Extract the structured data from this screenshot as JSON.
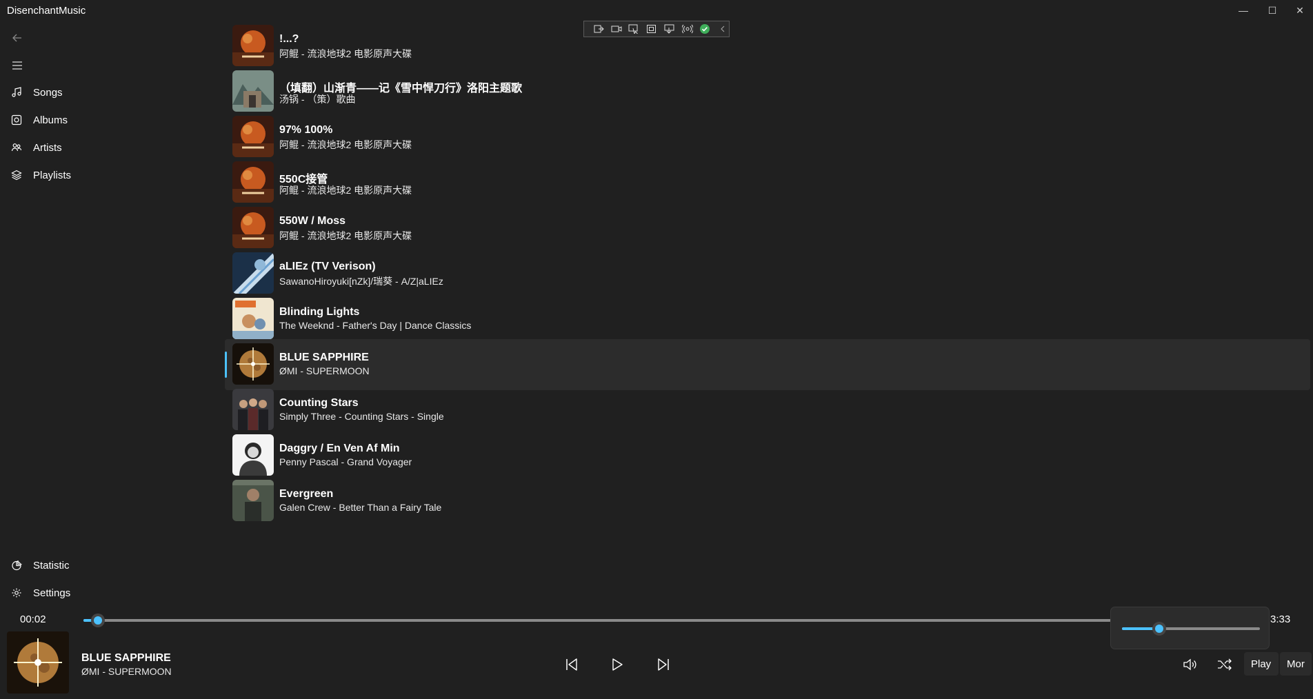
{
  "app": {
    "title": "DisenchantMusic",
    "window_buttons": {
      "minimize": "—",
      "maximize": "☐",
      "close": "✕"
    }
  },
  "sidebar": {
    "back_icon": "back-arrow-icon",
    "menu_icon": "hamburger-menu-icon",
    "items": [
      {
        "label": "Songs",
        "icon": "music-note-icon"
      },
      {
        "label": "Albums",
        "icon": "album-icon"
      },
      {
        "label": "Artists",
        "icon": "people-icon"
      },
      {
        "label": "Playlists",
        "icon": "layers-icon"
      }
    ],
    "footer_items": [
      {
        "label": "Statistic",
        "icon": "pie-chart-icon"
      },
      {
        "label": "Settings",
        "icon": "gear-icon"
      }
    ]
  },
  "songs": [
    {
      "title": "!...?",
      "subtitle": "阿鲲 - 流浪地球2 电影原声大碟",
      "cover": "wandering-earth"
    },
    {
      "title": "（填翻）山渐青——记《雪中悍刀行》洛阳主题歌",
      "subtitle": "汤锅 - （策）歌曲",
      "cover": "mountain"
    },
    {
      "title": "97% 100%",
      "subtitle": "阿鲲 - 流浪地球2 电影原声大碟",
      "cover": "wandering-earth"
    },
    {
      "title": "550C接管",
      "subtitle": "阿鲲 - 流浪地球2 电影原声大碟",
      "cover": "wandering-earth"
    },
    {
      "title": "550W / Moss",
      "subtitle": "阿鲲 - 流浪地球2 电影原声大碟",
      "cover": "wandering-earth"
    },
    {
      "title": "aLIEz (TV Verison)",
      "subtitle": "SawanoHiroyuki[nZk]/瑞葵 - A/Z|aLIEz",
      "cover": "aliez"
    },
    {
      "title": "Blinding Lights",
      "subtitle": "The Weeknd - Father's Day | Dance Classics",
      "cover": "fathers-day"
    },
    {
      "title": "BLUE SAPPHIRE",
      "subtitle": "ØMI - SUPERMOON",
      "cover": "supermoon",
      "selected": true
    },
    {
      "title": "Counting Stars",
      "subtitle": "Simply Three - Counting Stars - Single",
      "cover": "simply-three"
    },
    {
      "title": "Daggry / En Ven Af Min",
      "subtitle": "Penny Pascal - Grand Voyager",
      "cover": "portrait-bw"
    },
    {
      "title": "Evergreen",
      "subtitle": "Galen Crew - Better Than a Fairy Tale",
      "cover": "evergreen"
    }
  ],
  "player": {
    "current_time": "00:02",
    "total_time": "3:33",
    "progress_fraction": 0.014,
    "volume_fraction": 0.27,
    "now_playing": {
      "title": "BLUE SAPPHIRE",
      "subtitle": "ØMI - SUPERMOON"
    },
    "buttons": {
      "previous": "skip-previous-icon",
      "play": "play-icon",
      "next": "skip-next-icon",
      "volume": "speaker-icon",
      "shuffle": "shuffle-icon",
      "play_label": "Play",
      "more_label": "Mor"
    }
  },
  "colors": {
    "accent": "#4cc2ff",
    "background": "#202020",
    "selected_row": "#2c2c2c"
  }
}
